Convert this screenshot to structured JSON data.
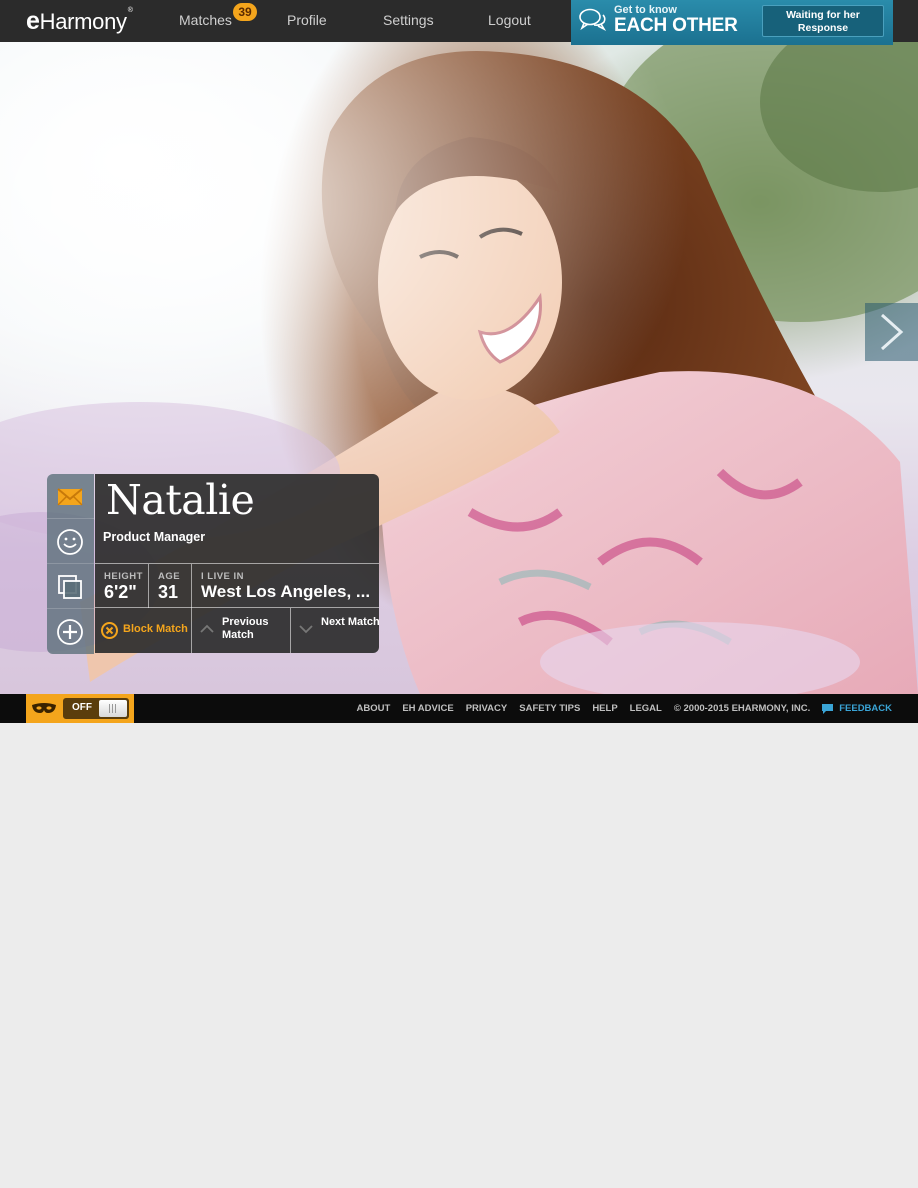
{
  "brand": {
    "logo_e": "e",
    "logo_rest": "Harmony",
    "logo_mark": "®"
  },
  "nav": {
    "matches": "Matches",
    "matches_count": "39",
    "profile": "Profile",
    "settings": "Settings",
    "logout": "Logout"
  },
  "promo": {
    "small": "Get to know",
    "big": "EACH OTHER",
    "button_line1": "Waiting for her",
    "button_line2": "Response",
    "icon": "chat-bubbles-icon"
  },
  "profile": {
    "name": "Natalie",
    "occupation": "Product Manager",
    "height_label": "HEIGHT",
    "height": "6'2\"",
    "age_label": "AGE",
    "age": "31",
    "location_label": "I LIVE IN",
    "location": "West Los Angeles, ...",
    "block_label": "Block Match",
    "previous_label": "Previous Match",
    "next_label": "Next Match"
  },
  "side_actions": [
    {
      "icon": "envelope-icon"
    },
    {
      "icon": "smiley-icon"
    },
    {
      "icon": "copy-icon"
    },
    {
      "icon": "plus-circle-icon"
    }
  ],
  "footer": {
    "toggle_state": "OFF",
    "links": [
      "ABOUT",
      "EH ADVICE",
      "PRIVACY",
      "SAFETY TIPS",
      "HELP",
      "LEGAL"
    ],
    "copyright": "© 2000-2015 EHARMONY, INC.",
    "feedback": "FEEDBACK"
  },
  "colors": {
    "accent_orange": "#f4a51c",
    "promo_blue": "#1f7f9f",
    "feedback_blue": "#3aa4d6",
    "topbar": "#2b2b2b"
  }
}
